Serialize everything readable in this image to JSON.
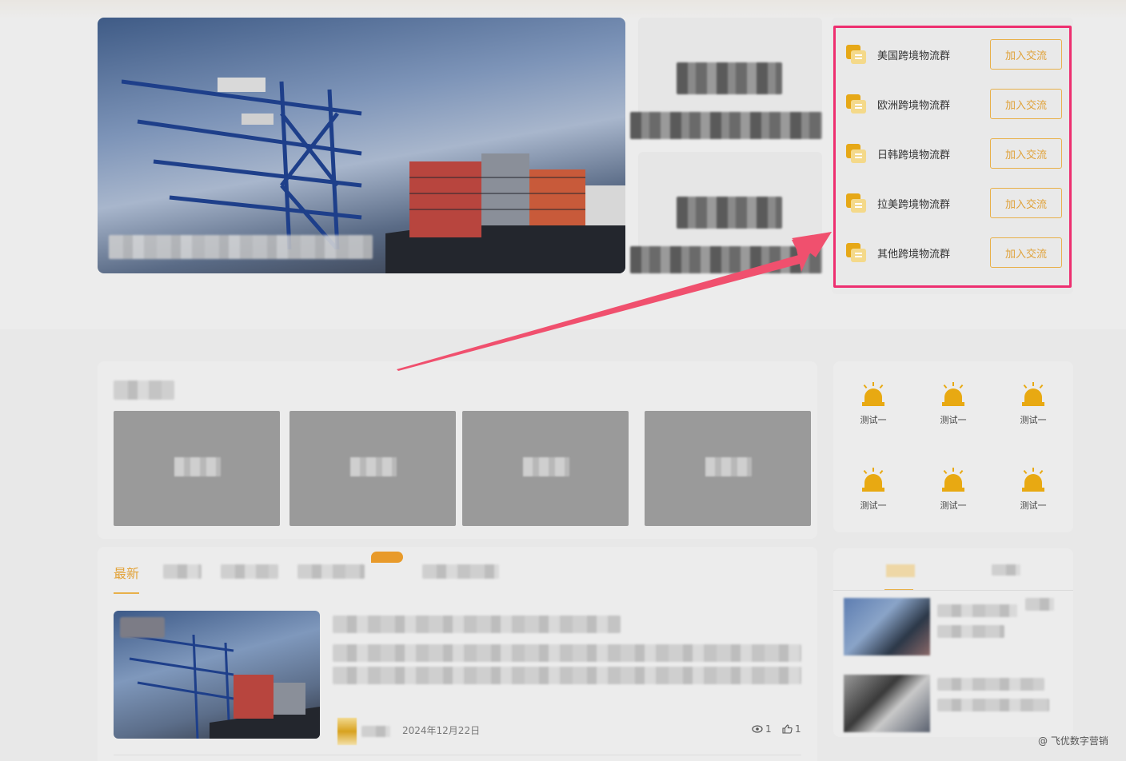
{
  "groups": {
    "items": [
      {
        "name": "美国跨境物流群",
        "action": "加入交流"
      },
      {
        "name": "欧洲跨境物流群",
        "action": "加入交流"
      },
      {
        "name": "日韩跨境物流群",
        "action": "加入交流"
      },
      {
        "name": "拉美跨境物流群",
        "action": "加入交流"
      },
      {
        "name": "其他跨境物流群",
        "action": "加入交流"
      }
    ]
  },
  "shortcuts": {
    "items": [
      {
        "label": "测试一"
      },
      {
        "label": "测试一"
      },
      {
        "label": "测试一"
      },
      {
        "label": "测试一"
      },
      {
        "label": "测试一"
      },
      {
        "label": "测试一"
      }
    ]
  },
  "feed": {
    "active_tab": "最新",
    "article": {
      "date": "2024年12月22日",
      "views": "1",
      "likes": "1"
    }
  },
  "watermark": "@ 飞优数字营销",
  "colors": {
    "accent": "#e8b04a",
    "highlight_frame": "#ee2f70",
    "arrow": "#f0506e"
  }
}
